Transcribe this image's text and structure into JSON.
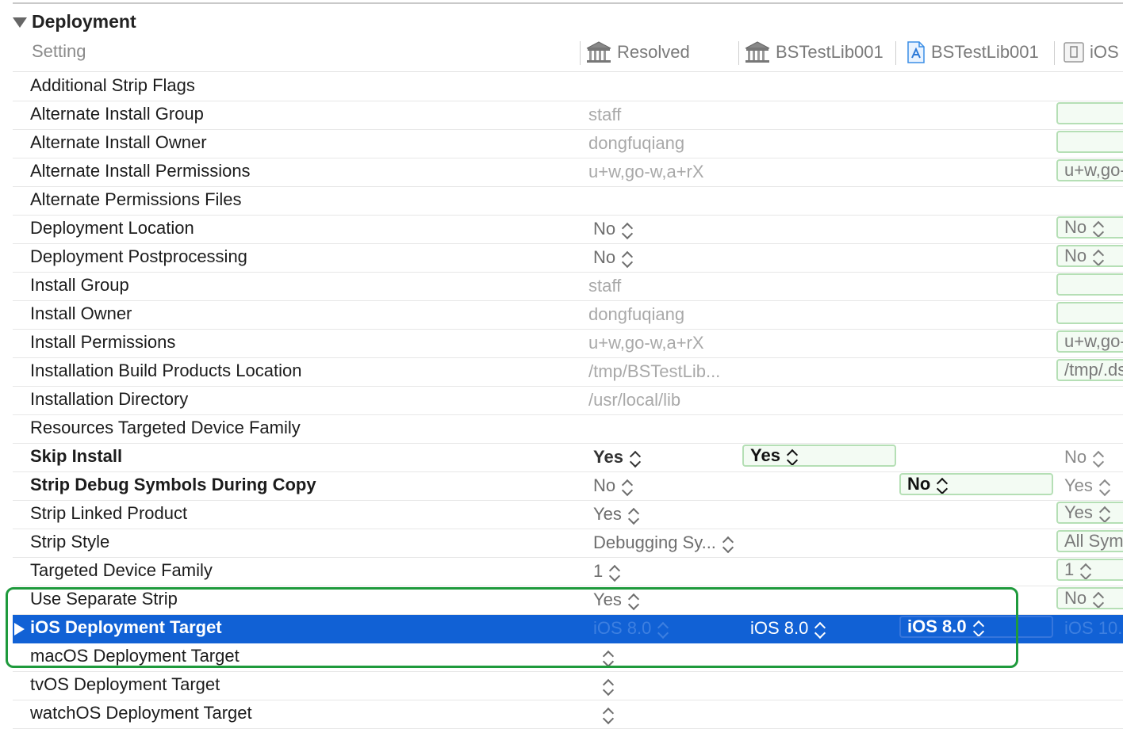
{
  "section": {
    "title": "Deployment"
  },
  "columns": {
    "setting": "Setting",
    "resolved": "Resolved",
    "col2": "BSTestLib001",
    "col3": "BSTestLib001",
    "col4": "iOS"
  },
  "rows": [
    {
      "name": "Additional Strip Flags",
      "resolved": "",
      "c2": "",
      "c3": "",
      "c4": "",
      "c4box": false
    },
    {
      "name": "Alternate Install Group",
      "resolved": "staff",
      "c2": "",
      "c3": "",
      "c4": "",
      "c4box": true
    },
    {
      "name": "Alternate Install Owner",
      "resolved": "dongfuqiang",
      "c2": "",
      "c3": "",
      "c4": "",
      "c4box": true
    },
    {
      "name": "Alternate Install Permissions",
      "resolved": "u+w,go-w,a+rX",
      "c2": "",
      "c3": "",
      "c4": "u+w,go-",
      "c4box": true
    },
    {
      "name": "Alternate Permissions Files",
      "resolved": "",
      "c2": "",
      "c3": "",
      "c4": "",
      "c4box": false
    },
    {
      "name": "Deployment Location",
      "resolved": "No",
      "c2": "",
      "c3": "",
      "c4": "No",
      "c4box": true
    },
    {
      "name": "Deployment Postprocessing",
      "resolved": "No",
      "c2": "",
      "c3": "",
      "c4": "No",
      "c4box": true
    },
    {
      "name": "Install Group",
      "resolved": "staff",
      "c2": "",
      "c3": "",
      "c4": "",
      "c4box": true
    },
    {
      "name": "Install Owner",
      "resolved": "dongfuqiang",
      "c2": "",
      "c3": "",
      "c4": "",
      "c4box": true
    },
    {
      "name": "Install Permissions",
      "resolved": "u+w,go-w,a+rX",
      "c2": "",
      "c3": "",
      "c4": "u+w,go-",
      "c4box": true
    },
    {
      "name": "Installation Build Products Location",
      "resolved": "/tmp/BSTestLib...",
      "c2": "",
      "c3": "",
      "c4": "/tmp/.ds",
      "c4box": true
    },
    {
      "name": "Installation Directory",
      "resolved": "/usr/local/lib",
      "c2": "",
      "c3": "",
      "c4": "",
      "c4box": false
    },
    {
      "name": "Resources Targeted Device Family",
      "resolved": "",
      "c2": "",
      "c3": "",
      "c4": "",
      "c4box": false
    },
    {
      "name": "Skip Install",
      "resolved": "Yes",
      "c2": "Yes",
      "c3": "",
      "c4": "No",
      "c4box": false
    },
    {
      "name": "Strip Debug Symbols During Copy",
      "resolved": "No",
      "c2": "",
      "c3": "No",
      "c4": "Yes",
      "c4box": false
    },
    {
      "name": "Strip Linked Product",
      "resolved": "Yes",
      "c2": "",
      "c3": "",
      "c4": "Yes",
      "c4box": true
    },
    {
      "name": "Strip Style",
      "resolved": "Debugging Sy...",
      "c2": "",
      "c3": "",
      "c4": "All Sym",
      "c4box": true
    },
    {
      "name": "Targeted Device Family",
      "resolved": "1",
      "c2": "",
      "c3": "",
      "c4": "1",
      "c4box": true
    },
    {
      "name": "Use Separate Strip",
      "resolved": "Yes",
      "c2": "",
      "c3": "",
      "c4": "No",
      "c4box": true
    },
    {
      "name": "iOS Deployment Target",
      "resolved": "iOS 8.0",
      "c2": "iOS 8.0",
      "c3": "iOS 8.0",
      "c4": "iOS 10.",
      "c4box": false
    },
    {
      "name": "macOS Deployment Target",
      "resolved": "",
      "c2": "",
      "c3": "",
      "c4": "",
      "c4box": false
    },
    {
      "name": "tvOS Deployment Target",
      "resolved": "",
      "c2": "",
      "c3": "",
      "c4": "",
      "c4box": false
    },
    {
      "name": "watchOS Deployment Target",
      "resolved": "",
      "c2": "",
      "c3": "",
      "c4": "",
      "c4box": false
    }
  ],
  "colors": {
    "selection": "#1161d5",
    "highlight_frame": "#1e9a3c",
    "box_fill": "#f3fbf3",
    "box_border": "#b5dfb5"
  },
  "icons": {
    "resolved": "building-icon",
    "project": "building-icon",
    "target": "app-target-icon",
    "platform": "ios-target-icon"
  }
}
